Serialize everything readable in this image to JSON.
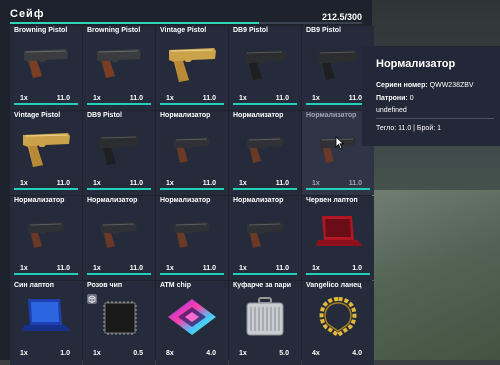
{
  "inventory": {
    "title": "Сейф",
    "capacity": "212.5/300",
    "capacity_fraction": 0.708,
    "items": [
      {
        "name": "Browning Pistol",
        "qty": "1x",
        "weight": "11.0",
        "icon": "pistol-dark-icon",
        "durability": 1.0
      },
      {
        "name": "Browning Pistol",
        "qty": "1x",
        "weight": "11.0",
        "icon": "pistol-dark-icon",
        "durability": 1.0
      },
      {
        "name": "Vintage Pistol",
        "qty": "1x",
        "weight": "11.0",
        "icon": "pistol-gold-icon",
        "durability": 1.0
      },
      {
        "name": "DB9 Pistol",
        "qty": "1x",
        "weight": "11.0",
        "icon": "pistol-black-icon",
        "durability": 1.0
      },
      {
        "name": "DB9 Pistol",
        "qty": "1x",
        "weight": "11.0",
        "icon": "pistol-black-icon",
        "durability": 1.0
      },
      {
        "name": "Vintage Pistol",
        "qty": "1x",
        "weight": "11.0",
        "icon": "pistol-gold-icon",
        "durability": 1.0
      },
      {
        "name": "DB9 Pistol",
        "qty": "1x",
        "weight": "11.0",
        "icon": "pistol-black-icon",
        "durability": 1.0
      },
      {
        "name": "Нормализатор",
        "qty": "1x",
        "weight": "11.0",
        "icon": "pistol-normalizer-icon",
        "durability": 1.0
      },
      {
        "name": "Нормализатор",
        "qty": "1x",
        "weight": "11.0",
        "icon": "pistol-normalizer-icon",
        "durability": 1.0
      },
      {
        "name": "Нормализатор",
        "qty": "1x",
        "weight": "11.0",
        "icon": "pistol-normalizer-icon",
        "durability": 1.0,
        "dimmed": true
      },
      {
        "name": "Нормализатор",
        "qty": "1x",
        "weight": "11.0",
        "icon": "pistol-normalizer-icon",
        "durability": 1.0
      },
      {
        "name": "Нормализатор",
        "qty": "1x",
        "weight": "11.0",
        "icon": "pistol-normalizer-icon",
        "durability": 1.0
      },
      {
        "name": "Нормализатор",
        "qty": "1x",
        "weight": "11.0",
        "icon": "pistol-normalizer-icon",
        "durability": 1.0
      },
      {
        "name": "Нормализатор",
        "qty": "1x",
        "weight": "11.0",
        "icon": "pistol-normalizer-icon",
        "durability": 1.0
      },
      {
        "name": "Червен лаптоп",
        "qty": "1x",
        "weight": "1.0",
        "icon": "laptop-red-icon",
        "durability": 1.0
      },
      {
        "name": "Син лаптоп",
        "qty": "1x",
        "weight": "1.0",
        "icon": "laptop-blue-icon"
      },
      {
        "name": "Розов чип",
        "qty": "1x",
        "weight": "0.5",
        "icon": "chip-black-icon",
        "badge": true
      },
      {
        "name": "ATM chip",
        "qty": "8x",
        "weight": "4.0",
        "icon": "chip-rainbow-icon"
      },
      {
        "name": "Куфарче за пари",
        "qty": "1x",
        "weight": "5.0",
        "icon": "briefcase-silver-icon"
      },
      {
        "name": "Vangelico ланец",
        "qty": "4x",
        "weight": "4.0",
        "icon": "gold-chain-icon"
      }
    ]
  },
  "tooltip": {
    "title": "Нормализатор",
    "serial_label": "Сериен номер:",
    "serial_value": "QWW238ZBV",
    "ammo_label": "Патрони:",
    "ammo_value": "0",
    "extra": "undefined",
    "footer": "Тегло: 11.0 | Брой: 1"
  },
  "colors": {
    "accent": "#2fd6b6",
    "panel": "#1c202c",
    "cell": "#262b3c"
  }
}
